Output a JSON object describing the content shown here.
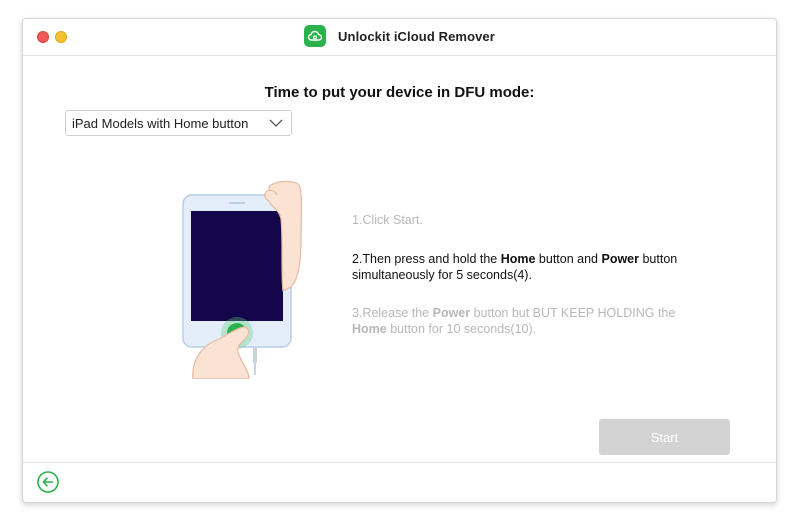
{
  "window": {
    "title": "Unlockit iCloud Remover"
  },
  "main": {
    "heading": "Time to put your device in DFU mode:",
    "model_select": {
      "selected": "iPad Models with Home button"
    },
    "steps": [
      {
        "state": "dim",
        "parts": [
          "1.Click Start."
        ]
      },
      {
        "state": "active",
        "pre": "2.Then press and hold the ",
        "b1": "Home",
        "mid": " button and ",
        "b2": "Power",
        "post": " button simultaneously for 5 seconds(4)."
      },
      {
        "state": "dim",
        "pre": "3.Release the ",
        "b1": "Power",
        "mid": " button but BUT KEEP HOLDING the ",
        "b2": "Home",
        "post": " button for 10 seconds(10)."
      }
    ],
    "start_label": "Start"
  },
  "colors": {
    "accent_green": "#2bb24c",
    "screen_dark": "#14064a",
    "button_disabled": "#d3d3d3"
  },
  "icons": {
    "app": "cloud-icon",
    "back": "arrow-left-circle-icon",
    "dropdown": "chevron-down-icon"
  }
}
